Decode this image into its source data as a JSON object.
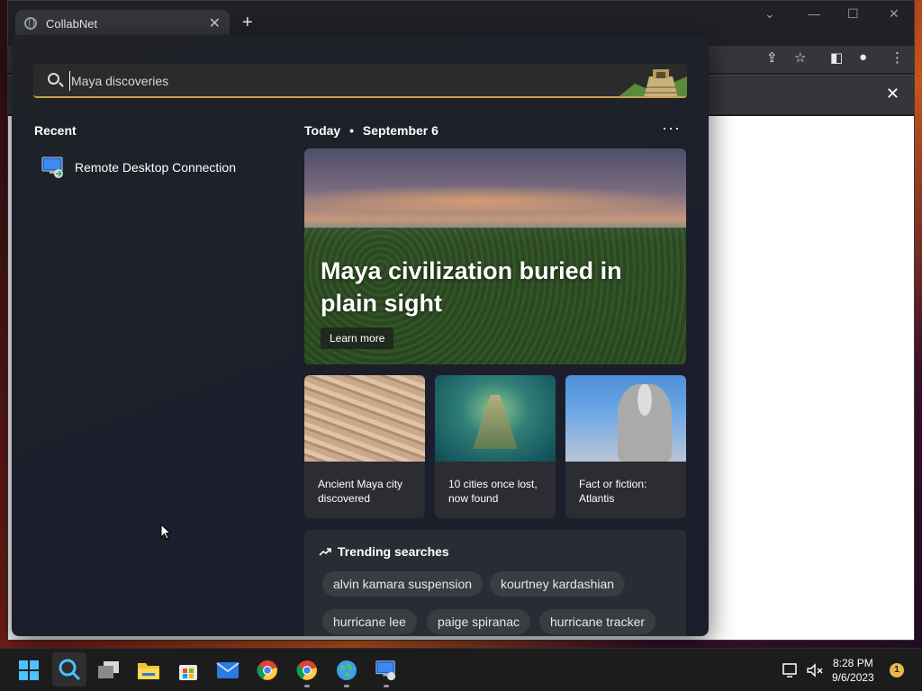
{
  "browser": {
    "tab_title": "CollabNet",
    "tab_close": "✕",
    "new_tab": "+"
  },
  "search": {
    "value": "Maya discoveries",
    "placeholder": "Maya discoveries"
  },
  "recent": {
    "title": "Recent",
    "items": [
      {
        "label": "Remote Desktop Connection",
        "icon": "remote-desktop-icon"
      }
    ]
  },
  "feed": {
    "today_label": "Today",
    "date_label": "September 6",
    "hero": {
      "title": "Maya civilization buried in plain sight",
      "button": "Learn more"
    },
    "cards": [
      {
        "caption": "Ancient Maya city discovered"
      },
      {
        "caption": "10 cities once lost, now found"
      },
      {
        "caption": "Fact or fiction: Atlantis"
      }
    ],
    "trending": {
      "title": "Trending searches",
      "chips": [
        "alvin kamara suspension",
        "kourtney kardashian",
        "hurricane lee",
        "paige spiranac",
        "hurricane tracker"
      ]
    }
  },
  "taskbar": {
    "time": "8:28 PM",
    "date": "9/6/2023",
    "notifications": "1",
    "apps": [
      "start-icon",
      "search-icon",
      "task-view-icon",
      "file-explorer-icon",
      "microsoft-store-icon",
      "mail-icon",
      "chrome-icon",
      "chrome-icon",
      "globe-app-icon",
      "remote-desktop-icon"
    ]
  },
  "colors": {
    "accent": "#c8a24a",
    "flyout_bg": "#1f2127",
    "chip_bg": "#3a3c43"
  }
}
